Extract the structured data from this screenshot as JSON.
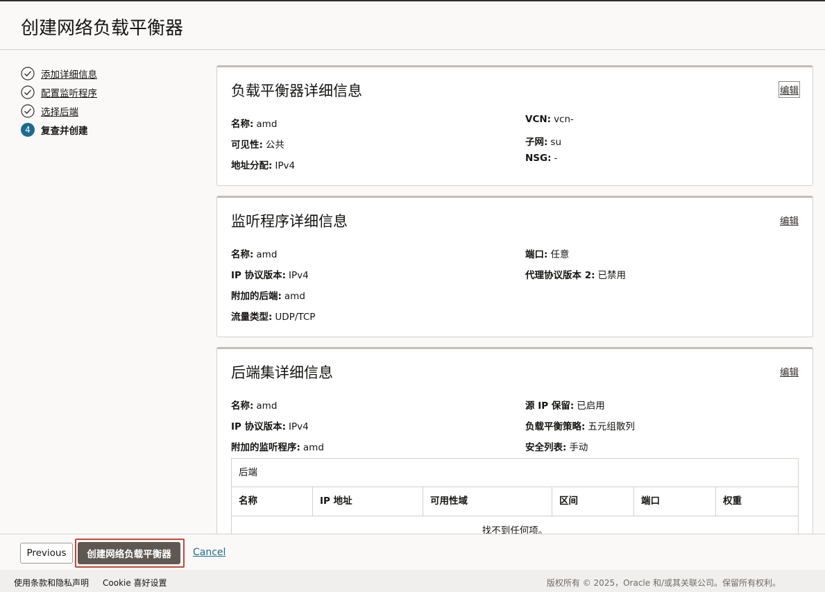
{
  "page": {
    "title": "创建网络负载平衡器"
  },
  "steps": [
    {
      "label": "添加详细信息",
      "state": "done"
    },
    {
      "label": "配置监听程序",
      "state": "done"
    },
    {
      "label": "选择后端",
      "state": "done"
    },
    {
      "label": "复查并创建",
      "state": "current",
      "number": "4"
    }
  ],
  "lb_card": {
    "title": "负载平衡器详细信息",
    "edit": "编辑",
    "left": [
      {
        "k": "名称:",
        "v": "amd"
      },
      {
        "k": "可见性:",
        "v": "公共"
      },
      {
        "k": "地址分配:",
        "v": "IPv4"
      }
    ],
    "right": [
      {
        "k": "VCN:",
        "v": "vcn-"
      },
      {
        "k": "子网:",
        "v": "su"
      },
      {
        "k": "NSG:",
        "v": "-"
      }
    ]
  },
  "listener_card": {
    "title": "监听程序详细信息",
    "edit": "编辑",
    "left": [
      {
        "k": "名称:",
        "v": "amd"
      },
      {
        "k": "IP 协议版本:",
        "v": "IPv4"
      },
      {
        "k": "附加的后端:",
        "v": "amd"
      },
      {
        "k": "流量类型:",
        "v": "UDP/TCP"
      }
    ],
    "right": [
      {
        "k": "端口:",
        "v": "任意"
      },
      {
        "k": "代理协议版本 2:",
        "v": "已禁用"
      }
    ]
  },
  "backend_card": {
    "title": "后端集详细信息",
    "edit": "编辑",
    "left": [
      {
        "k": "名称:",
        "v": "amd"
      },
      {
        "k": "IP 协议版本:",
        "v": "IPv4"
      },
      {
        "k": "附加的监听程序:",
        "v": "amd"
      }
    ],
    "right": [
      {
        "k": "源 IP 保留:",
        "v": "已启用"
      },
      {
        "k": "负载平衡策略:",
        "v": "五元组散列"
      },
      {
        "k": "安全列表:",
        "v": "手动"
      }
    ],
    "table": {
      "caption": "后端",
      "columns": [
        "名称",
        "IP 地址",
        "可用性域",
        "区间",
        "端口",
        "权重"
      ],
      "empty": "找不到任何项。"
    }
  },
  "actions": {
    "previous": "Previous",
    "create": "创建网络负载平衡器",
    "cancel": "Cancel"
  },
  "footer": {
    "terms": "使用条款和隐私声明",
    "cookie": "Cookie 喜好设置",
    "copyright": "版权所有 © 2025，Oracle 和/或其关联公司。保留所有权利。"
  },
  "colors": {
    "accent": "#1c6b8e",
    "primary_button": "#5f5852",
    "focus_ring": "#c74634"
  }
}
